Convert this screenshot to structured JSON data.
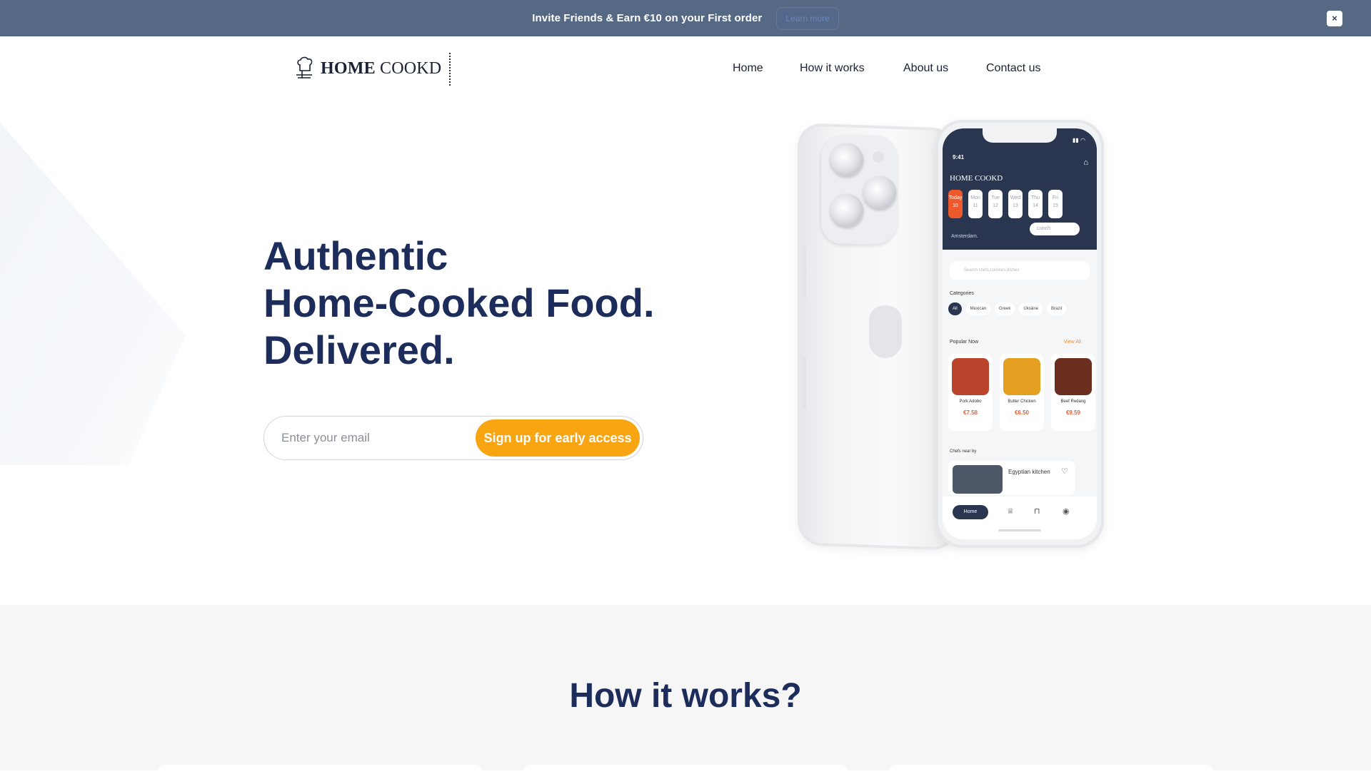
{
  "promo": {
    "text": "Invite Friends & Earn €10 on your First order",
    "button": "Learn more",
    "close": "×"
  },
  "header": {
    "logo_bold": "HOME",
    "logo_regular": " COOKD",
    "nav": [
      "Home",
      "How it works",
      "About us",
      "Contact us"
    ]
  },
  "hero": {
    "title_lines": [
      "Authentic",
      "Home-Cooked Food.",
      "Delivered."
    ],
    "email_placeholder": "Enter your email",
    "cta": "Sign up for early access"
  },
  "app_screen": {
    "time": "9:41",
    "logo": "HOME COOKD",
    "days": [
      {
        "label": "Today",
        "num": "10",
        "active": true
      },
      {
        "label": "Mon",
        "num": "11"
      },
      {
        "label": "Tue",
        "num": "12"
      },
      {
        "label": "Wed",
        "num": "13"
      },
      {
        "label": "Thu",
        "num": "14"
      },
      {
        "label": "Fri",
        "num": "15"
      }
    ],
    "location": "Amsterdam.",
    "meal": "Lunch",
    "search_placeholder": "Search chefs,cuisines,dishes",
    "categories_title": "Categories",
    "categories": [
      "All",
      "Mexican",
      "Greek",
      "Ukraine",
      "Brazil"
    ],
    "popular_title": "Popular Now",
    "view_all": "View All",
    "dishes": [
      {
        "name": "Pork Adobo",
        "price": "€7.58",
        "color": "#b8452c"
      },
      {
        "name": "Butter Chicken",
        "price": "€6.50",
        "color": "#e6a021"
      },
      {
        "name": "Beef Redang",
        "price": "€9.59",
        "color": "#6b2f1f"
      }
    ],
    "chefs_title": "Chefs near by",
    "chef": {
      "name": "Egyptian kitchen"
    },
    "tab_home": "Home"
  },
  "how_it_works": {
    "title": "How it works?"
  },
  "colors": {
    "navy": "#1d2d5b",
    "accent": "#f9a411",
    "banner": "#566984"
  }
}
